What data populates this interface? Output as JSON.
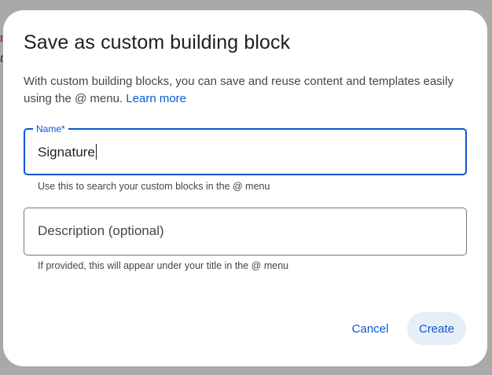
{
  "background": {
    "fragment_red": "n",
    "fragment_dark": "t"
  },
  "dialog": {
    "title": "Save as custom building block",
    "intro_text": "With custom building blocks, you can save and reuse content and templates easily using the @ menu.",
    "learn_more_link": "Learn more",
    "name_field": {
      "label": "Name*",
      "value": "Signature",
      "helper": "Use this to search your custom blocks in the @ menu"
    },
    "description_field": {
      "placeholder": "Description (optional)",
      "value": "",
      "helper": "If provided, this will appear under your title in the @ menu"
    },
    "buttons": {
      "cancel": "Cancel",
      "create": "Create"
    }
  },
  "colors": {
    "accent": "#0b57d0",
    "backdrop": "#a9a9a9",
    "create_button_bg": "#e8eef8",
    "text_primary": "#1f1f1f",
    "text_secondary": "#444746"
  }
}
